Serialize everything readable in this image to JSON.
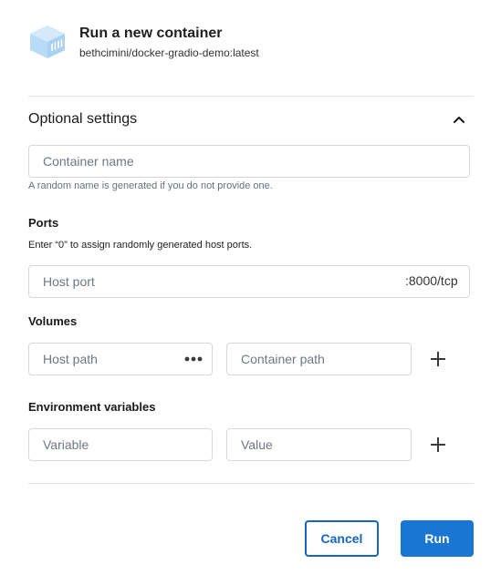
{
  "header": {
    "title": "Run a new container",
    "image_name": "bethcimini/docker-gradio-demo:latest",
    "icon": "container-image-icon"
  },
  "optional_settings": {
    "title": "Optional settings",
    "collapse_icon": "chevron-up-icon",
    "container_name": {
      "placeholder": "Container name",
      "value": "",
      "helper": "A random name is generated if you do not provide one."
    }
  },
  "ports": {
    "label": "Ports",
    "description": "Enter “0” to assign randomly generated host ports.",
    "host_port_placeholder": "Host port",
    "container_port": ":8000/tcp"
  },
  "volumes": {
    "label": "Volumes",
    "host_path_placeholder": "Host path",
    "browse_icon": "more-horizontal-icon",
    "container_path_placeholder": "Container path",
    "add_icon": "plus-icon"
  },
  "env": {
    "label": "Environment variables",
    "variable_placeholder": "Variable",
    "value_placeholder": "Value",
    "add_icon": "plus-icon"
  },
  "actions": {
    "cancel": "Cancel",
    "run": "Run"
  },
  "colors": {
    "primary": "#1976d2",
    "cancel_border": "#1565c0",
    "icon_blue": "#b9dcf6"
  }
}
